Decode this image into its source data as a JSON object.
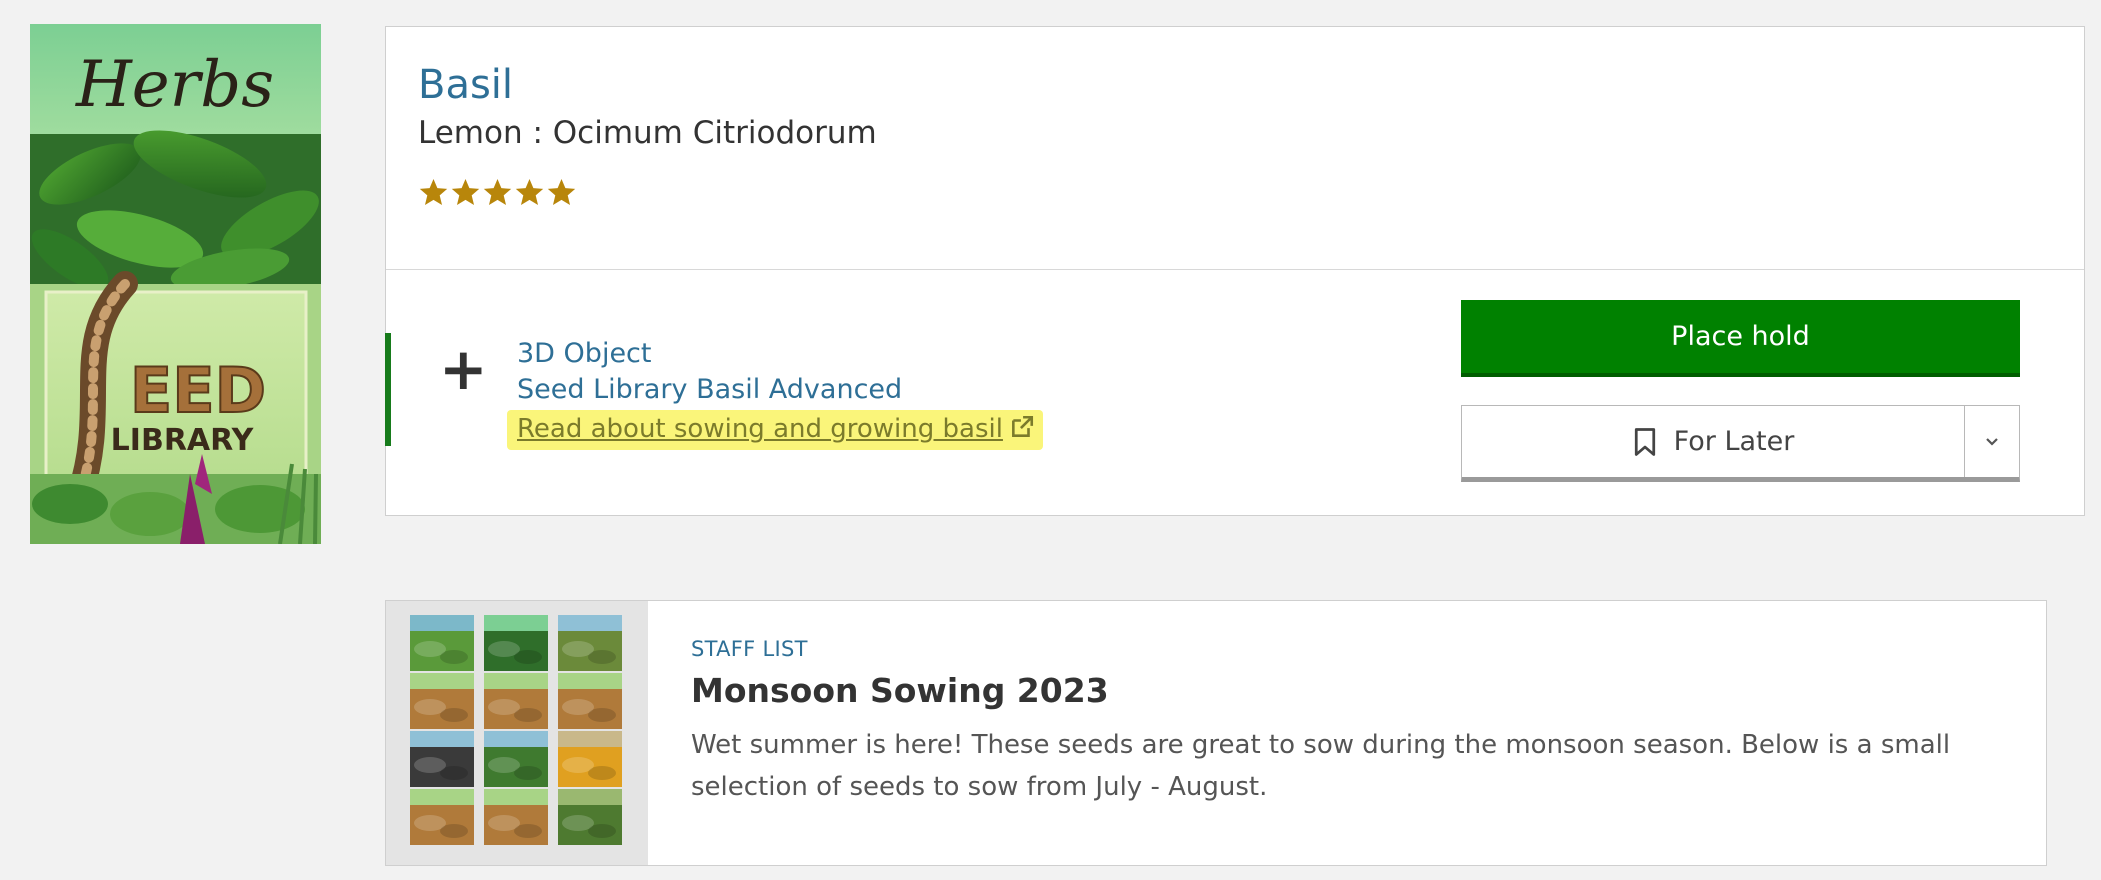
{
  "cover": {
    "top_word": "Herbs",
    "brand_word": "SEED",
    "brand_word2": "LIBRARY"
  },
  "record": {
    "title": "Basil",
    "subtitle": "Lemon : Ocimum Citriodorum",
    "rating": 5,
    "rating_max": 5,
    "format_type": "3D Object",
    "format_name": "Seed Library Basil Advanced",
    "read_link": "Read about sowing and growing basil",
    "place_hold_label": "Place hold",
    "for_later_label": "For Later"
  },
  "staff_list": {
    "eyebrow": "STAFF LIST",
    "title": "Monsoon Sowing 2023",
    "description": "Wet summer is here! These seeds are great to sow during the monsoon season. Below is a small selection of seeds to sow from July - August."
  },
  "colors": {
    "link_blue": "#2e6f96",
    "hold_green": "#008100",
    "star_gold": "#b8860b",
    "highlight": "#faf57a"
  }
}
